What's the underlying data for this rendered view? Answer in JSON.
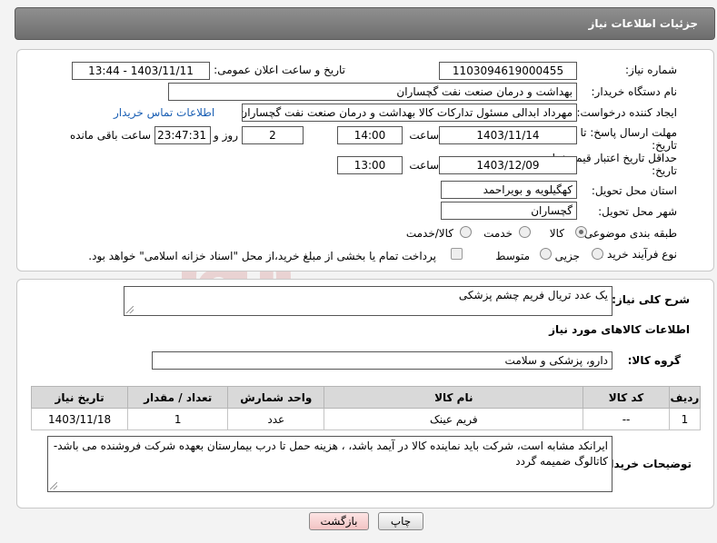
{
  "header": {
    "title": "جزئیات اطلاعات نیاز"
  },
  "form": {
    "need_number_label": "شماره نیاز:",
    "need_number": "1103094619000455",
    "announce_label": "تاریخ و ساعت اعلان عمومی:",
    "announce_value": "1403/11/11 - 13:44",
    "buyer_org_label": "نام دستگاه خریدار:",
    "buyer_org": "بهداشت و درمان صنعت نفت گچساران",
    "creator_label": "ایجاد کننده درخواست:",
    "creator": "مهرداد ابدالی مسئول تدارکات کالا  بهداشت و درمان صنعت نفت گچساران",
    "contact_link": "اطلاعات تماس خریدار",
    "deadline_label_1": "مهلت ارسال پاسخ: تا",
    "deadline_label_2": "تاریخ:",
    "deadline_date": "1403/11/14",
    "time_label": "ساعت",
    "deadline_time": "14:00",
    "days_value": "2",
    "days_label": "روز و",
    "remaining_value": "23:47:31",
    "remaining_label": "ساعت باقی مانده",
    "validity_label_1": "حداقل تاریخ اعتبار قیمت: تا",
    "validity_label_2": "تاریخ:",
    "validity_date": "1403/12/09",
    "validity_time": "13:00",
    "province_label": "استان محل تحویل:",
    "province": "کهگیلویه و بویراحمد",
    "city_label": "شهر محل تحویل:",
    "city": "گچساران",
    "category_label": "طبقه بندی موضوعی:",
    "category_options": [
      "کالا",
      "خدمت",
      "کالا/خدمت"
    ],
    "process_label": "نوع فرآیند خرید :",
    "process_options": [
      "جزیی",
      "متوسط"
    ],
    "payment_text": "پرداخت تمام یا بخشی از مبلغ خرید،از محل \"اسناد خزانه اسلامی\" خواهد بود."
  },
  "details": {
    "description_label": "شرح کلی نیاز:",
    "description": "یک عدد تریال فریم چشم پزشکی",
    "goods_info_title": "اطلاعات کالاهای مورد نیاز",
    "goods_group_label": "گروه کالا:",
    "goods_group": "دارو، پزشکی و سلامت",
    "table": {
      "headers": [
        "ردیف",
        "کد کالا",
        "نام کالا",
        "واحد شمارش",
        "تعداد / مقدار",
        "تاریخ نیاز"
      ],
      "rows": [
        [
          "1",
          "--",
          "فریم عینک",
          "عدد",
          "1",
          "1403/11/18"
        ]
      ]
    },
    "buyer_notes_label": "توضیحات خریدار:",
    "buyer_notes": "ایرانکد مشابه است، شرکت باید نماینده کالا در آیمد باشد، ، هزینه حمل تا درب بیمارستان بعهده شرکت فروشنده می باشد- کاتالوگ ضمیمه گردد"
  },
  "buttons": {
    "print": "چاپ",
    "back": "بازگشت"
  },
  "watermark": {
    "text": "AriaTender.neT"
  }
}
